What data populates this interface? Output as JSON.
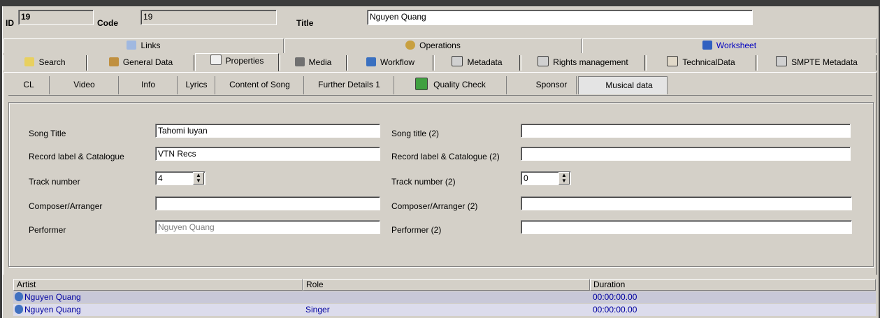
{
  "header": {
    "id_label": "ID",
    "id_value": "19",
    "code_label": "Code",
    "code_value": "19",
    "title_label": "Title",
    "title_value": "Nguyen Quang"
  },
  "tabs_top": [
    {
      "label": "Links",
      "icon": "links-icon"
    },
    {
      "label": "Operations",
      "icon": "operations-icon"
    },
    {
      "label": "Worksheet",
      "icon": "worksheet-icon"
    }
  ],
  "tabs_main": [
    {
      "label": "Search",
      "icon": "search-icon"
    },
    {
      "label": "General Data",
      "icon": "calendar-icon"
    },
    {
      "label": "Properties",
      "icon": "properties-icon",
      "active": true
    },
    {
      "label": "Media",
      "icon": "media-icon"
    },
    {
      "label": "Workflow",
      "icon": "workflow-icon"
    },
    {
      "label": "Metadata",
      "icon": "metadata-icon"
    },
    {
      "label": "Rights management",
      "icon": "rights-icon"
    },
    {
      "label": "TechnicalData",
      "icon": "technical-icon"
    },
    {
      "label": "SMPTE Metadata",
      "icon": "smpte-icon"
    }
  ],
  "subtabs": [
    "CL",
    "Video",
    "Info",
    "Lyrics",
    "Content of Song",
    "Further Details 1",
    "Quality Check",
    "Sponsor",
    "Musical data"
  ],
  "subtab_active": "Musical data",
  "form": {
    "left": [
      {
        "label": "Song Title",
        "value": "Tahomi luyan"
      },
      {
        "label": "Record label & Catalogue",
        "value": "VTN Recs"
      },
      {
        "label": "Track number",
        "value": "4"
      },
      {
        "label": "Composer/Arranger",
        "value": ""
      },
      {
        "label": "Performer",
        "value": "Nguyen Quang"
      }
    ],
    "right": [
      {
        "label": "Song title (2)",
        "value": ""
      },
      {
        "label": "Record label & Catalogue (2)",
        "value": ""
      },
      {
        "label": "Track number (2)",
        "value": "0"
      },
      {
        "label": "Composer/Arranger (2)",
        "value": ""
      },
      {
        "label": "Performer (2)",
        "value": ""
      }
    ]
  },
  "grid": {
    "columns": [
      "Artist",
      "Role",
      "Duration"
    ],
    "rows": [
      {
        "artist": "Nguyen Quang",
        "role": "",
        "duration": "00:00:00.00"
      },
      {
        "artist": "Nguyen Quang",
        "role": "Singer",
        "duration": "00:00:00.00"
      }
    ]
  },
  "colors": {
    "link_blue": "#0000a0",
    "window_bg": "#d4d0c8",
    "title_bar_bg": "#3c3c3c"
  }
}
